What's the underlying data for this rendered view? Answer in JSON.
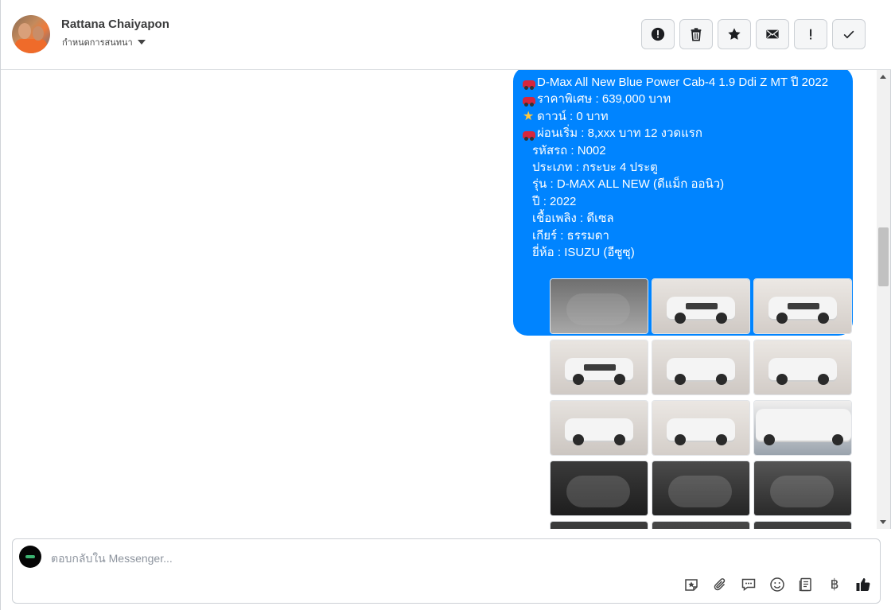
{
  "header": {
    "contact_name": "Rattana Chaiyapon",
    "assign_label": "กำหนดการสนทนา",
    "toolbar": [
      {
        "name": "mark-spam-button",
        "icon": "alert-circle-icon"
      },
      {
        "name": "delete-button",
        "icon": "trash-icon"
      },
      {
        "name": "star-button",
        "icon": "star-icon"
      },
      {
        "name": "mark-unread-button",
        "icon": "envelope-icon"
      },
      {
        "name": "follow-up-button",
        "icon": "exclamation-icon"
      },
      {
        "name": "mark-done-button",
        "icon": "check-icon"
      }
    ]
  },
  "message": {
    "lines": [
      "D-Max All New Blue Power Cab-4 1.9 Ddi Z MT ปี 2022",
      "ราคาพิเศษ : 639,000 บาท",
      " ดาวน์ : 0 บาท",
      " ผ่อนเริ่ม : 8,xxx บาท 12 งวดแรก",
      "รหัสรถ : N002",
      "ประเภท : กระบะ 4 ประตู",
      "รุ่น : D-MAX ALL NEW (ดีแม็ก ออนิว)",
      "ปี : 2022",
      "เชื้อเพลิง : ดีเซล",
      "เกียร์ : ธรรมดา",
      "ยี่ห้อ : ISUZU (อีซูซุ)"
    ],
    "line_emoji": [
      "car",
      "car",
      "star",
      "car",
      "",
      "",
      "",
      "",
      "",
      "",
      ""
    ]
  },
  "photos": {
    "count_visible": 15,
    "items": [
      "engine",
      "front-left",
      "front",
      "side-front",
      "rear-left",
      "rear",
      "rear-quarter",
      "side",
      "wheel",
      "door-interior",
      "dashboard",
      "gear-shifter",
      "interior-a",
      "interior-b",
      "interior-c"
    ]
  },
  "composer": {
    "placeholder": "ตอบกลับใน Messenger...",
    "tools": [
      "sticker-icon",
      "attachment-icon",
      "saved-reply-icon",
      "emoji-icon",
      "notes-icon",
      "baht-icon",
      "like-icon"
    ],
    "baht_symbol": "฿"
  }
}
